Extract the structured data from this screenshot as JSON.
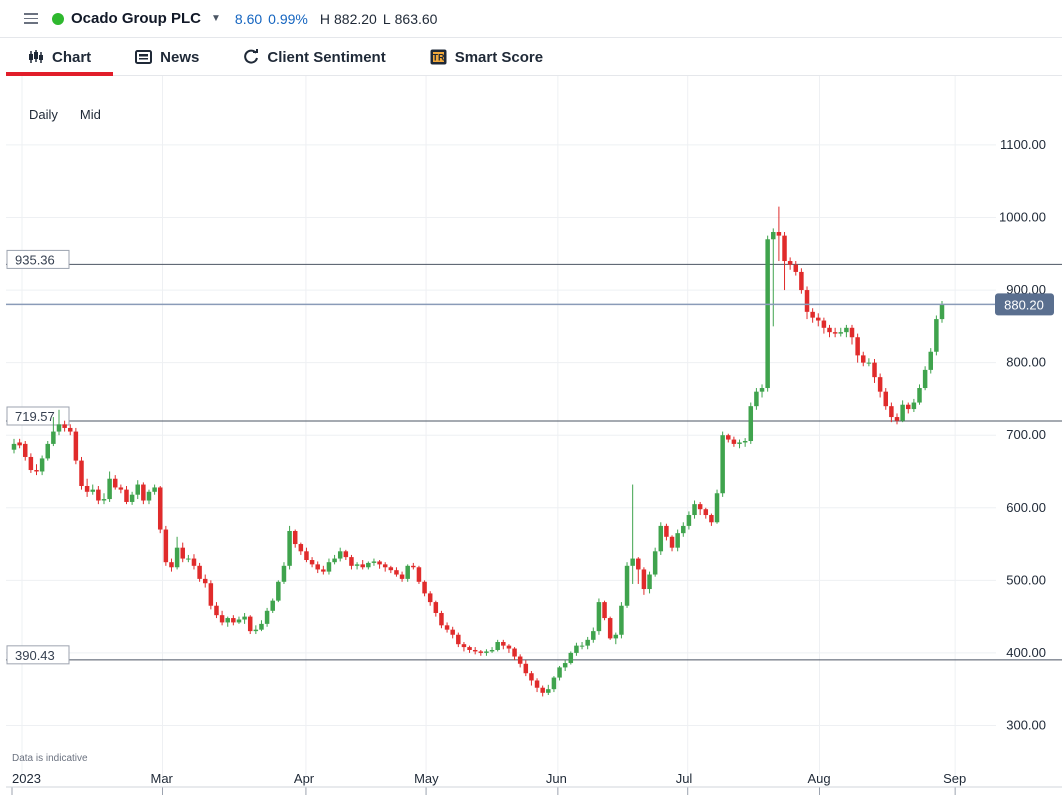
{
  "header": {
    "instrument_name": "Ocado Group PLC",
    "status_color": "#2eb82e",
    "change": "8.60",
    "change_pct": "0.99%",
    "high_label": "H",
    "high": "882.20",
    "low_label": "L",
    "low": "863.60",
    "change_color": "#1565c0"
  },
  "tabs": [
    {
      "label": "Chart",
      "icon": "candlestick-icon",
      "active": true
    },
    {
      "label": "News",
      "icon": "newspaper-icon",
      "active": false
    },
    {
      "label": "Client Sentiment",
      "icon": "refresh-icon",
      "active": false
    },
    {
      "label": "Smart Score",
      "icon": "smart-score-icon",
      "active": false
    }
  ],
  "chart_info": {
    "interval": "Daily",
    "price_type": "Mid"
  },
  "disclaimer": "Data is indicative",
  "chart_data": {
    "type": "candlestick",
    "ylim": [
      240,
      1195
    ],
    "y_ticks": [
      "1100.00",
      "1000.00",
      "900.00",
      "800.00",
      "700.00",
      "600.00",
      "500.00",
      "400.00",
      "300.00"
    ],
    "x_labels": [
      "2023",
      "Mar",
      "Apr",
      "May",
      "Jun",
      "Jul",
      "Aug",
      "Sep"
    ],
    "current_price": {
      "value": 880.2,
      "label": "880.20",
      "color": "#5a6f8f"
    },
    "horizontal_lines": [
      {
        "value": 935.36,
        "label": "935.36"
      },
      {
        "value": 719.57,
        "label": "719.57"
      },
      {
        "value": 390.43,
        "label": "390.43"
      }
    ],
    "up_color": "#3fa34d",
    "down_color": "#e02b2b",
    "series": [
      {
        "close": [
          688,
          686,
          670,
          652,
          650,
          668,
          688,
          705,
          715,
          710,
          705,
          665,
          630,
          622,
          625,
          610,
          612,
          640,
          628,
          625,
          608,
          618,
          632,
          610,
          622,
          628,
          570,
          525,
          518,
          545,
          530,
          530,
          520,
          502,
          496,
          465,
          452,
          442,
          448,
          442,
          446,
          450,
          430,
          432,
          440,
          458,
          472,
          498,
          520,
          568,
          550,
          540,
          528,
          522,
          515,
          512,
          525,
          530,
          540,
          532,
          520,
          522,
          518,
          524,
          526,
          522,
          518,
          514,
          508,
          502,
          520,
          518,
          498,
          482,
          470,
          455,
          438,
          432,
          425,
          412,
          408,
          404,
          402,
          400,
          402,
          404,
          415,
          410,
          406,
          395,
          385,
          372,
          362,
          352,
          345,
          350,
          366,
          380,
          386,
          400,
          410,
          410,
          418,
          430,
          470,
          448,
          420,
          425,
          465,
          520,
          530,
          515,
          488,
          508,
          540,
          575,
          560,
          545,
          565,
          575,
          590,
          605,
          598,
          590,
          580,
          620,
          700,
          694,
          688,
          690,
          692,
          740,
          760,
          765,
          970,
          980,
          975,
          940,
          935,
          925,
          900,
          870,
          862,
          858,
          848,
          842,
          840,
          842,
          848,
          835,
          810,
          800,
          800,
          780,
          760,
          740,
          725,
          720,
          742,
          736,
          745,
          765,
          790,
          815,
          860,
          880
        ],
        "open": [
          680,
          690,
          688,
          670,
          652,
          650,
          668,
          688,
          705,
          715,
          710,
          705,
          665,
          630,
          622,
          625,
          610,
          612,
          640,
          628,
          625,
          608,
          618,
          632,
          610,
          622,
          628,
          570,
          525,
          518,
          545,
          530,
          530,
          520,
          502,
          496,
          465,
          452,
          442,
          448,
          442,
          446,
          450,
          430,
          432,
          440,
          458,
          472,
          498,
          520,
          568,
          550,
          540,
          528,
          522,
          515,
          512,
          525,
          530,
          540,
          532,
          520,
          522,
          518,
          524,
          526,
          522,
          518,
          514,
          508,
          502,
          520,
          518,
          498,
          482,
          470,
          455,
          438,
          432,
          425,
          412,
          408,
          404,
          402,
          400,
          402,
          404,
          415,
          410,
          406,
          395,
          385,
          372,
          362,
          352,
          345,
          350,
          366,
          380,
          386,
          400,
          410,
          410,
          418,
          430,
          470,
          448,
          420,
          425,
          465,
          520,
          530,
          515,
          488,
          508,
          540,
          575,
          560,
          545,
          565,
          575,
          590,
          605,
          598,
          590,
          580,
          620,
          700,
          694,
          688,
          690,
          692,
          740,
          760,
          765,
          970,
          980,
          975,
          940,
          935,
          925,
          900,
          870,
          862,
          858,
          848,
          842,
          840,
          842,
          848,
          835,
          810,
          800,
          800,
          780,
          760,
          740,
          725,
          720,
          742,
          736,
          745,
          765,
          790,
          815,
          860
        ],
        "high": [
          695,
          695,
          692,
          675,
          660,
          672,
          692,
          725,
          735,
          720,
          715,
          710,
          670,
          640,
          632,
          630,
          620,
          650,
          645,
          632,
          630,
          622,
          638,
          635,
          625,
          632,
          630,
          575,
          530,
          560,
          552,
          535,
          536,
          524,
          508,
          500,
          470,
          458,
          450,
          452,
          450,
          455,
          452,
          438,
          445,
          462,
          475,
          500,
          525,
          575,
          570,
          552,
          545,
          532,
          526,
          520,
          530,
          535,
          545,
          542,
          535,
          525,
          528,
          526,
          530,
          528,
          525,
          520,
          518,
          512,
          522,
          524,
          520,
          500,
          485,
          472,
          458,
          442,
          436,
          428,
          415,
          410,
          408,
          404,
          405,
          408,
          418,
          418,
          412,
          408,
          398,
          390,
          375,
          365,
          355,
          356,
          368,
          382,
          390,
          402,
          414,
          415,
          422,
          435,
          475,
          472,
          450,
          428,
          470,
          525,
          632,
          532,
          518,
          512,
          545,
          580,
          578,
          562,
          570,
          580,
          595,
          610,
          608,
          600,
          592,
          625,
          705,
          702,
          698,
          694,
          696,
          745,
          765,
          770,
          975,
          985,
          1015,
          980,
          945,
          940,
          930,
          905,
          875,
          868,
          862,
          852,
          848,
          848,
          852,
          852,
          840,
          815,
          806,
          805,
          785,
          765,
          745,
          730,
          748,
          745,
          750,
          770,
          795,
          820,
          865,
          885
        ],
        "low": [
          675,
          682,
          665,
          648,
          645,
          645,
          665,
          685,
          700,
          705,
          700,
          660,
          625,
          615,
          618,
          605,
          605,
          608,
          625,
          620,
          605,
          604,
          612,
          605,
          605,
          618,
          565,
          520,
          512,
          515,
          525,
          525,
          515,
          498,
          490,
          460,
          448,
          438,
          436,
          438,
          440,
          440,
          426,
          426,
          430,
          436,
          455,
          470,
          495,
          515,
          545,
          535,
          525,
          518,
          510,
          508,
          508,
          522,
          526,
          528,
          515,
          515,
          515,
          515,
          520,
          516,
          512,
          510,
          505,
          498,
          498,
          515,
          495,
          478,
          465,
          450,
          434,
          428,
          420,
          408,
          402,
          400,
          398,
          396,
          396,
          400,
          402,
          405,
          400,
          390,
          380,
          368,
          355,
          346,
          340,
          342,
          346,
          362,
          375,
          384,
          396,
          405,
          405,
          414,
          425,
          445,
          418,
          412,
          420,
          462,
          495,
          495,
          480,
          482,
          505,
          535,
          555,
          540,
          540,
          560,
          570,
          585,
          590,
          585,
          575,
          578,
          615,
          690,
          684,
          682,
          684,
          688,
          735,
          752,
          760,
          850,
          940,
          900,
          928,
          920,
          895,
          860,
          855,
          850,
          840,
          835,
          835,
          836,
          835,
          825,
          800,
          795,
          795,
          772,
          752,
          735,
          718,
          715,
          718,
          730,
          732,
          742,
          762,
          785,
          810,
          855
        ]
      }
    ]
  }
}
